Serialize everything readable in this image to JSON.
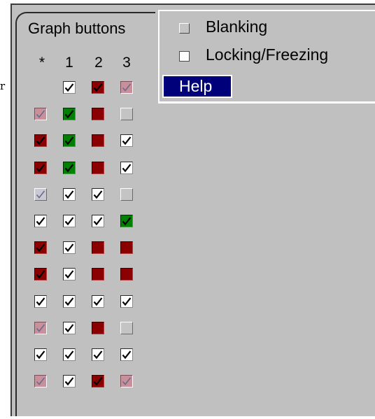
{
  "stray_text": "r",
  "graph_buttons": {
    "title": "Graph buttons",
    "column_headers": [
      "*",
      "1",
      "2",
      "3"
    ],
    "colors": {
      "white": "#ffffff",
      "red": "#8b0000",
      "green": "#008000",
      "pink": "#c8909a",
      "grey": "#c4c4c4",
      "light": "#c9c9d4"
    },
    "rows": [
      [
        null,
        {
          "state": "white",
          "checked": true
        },
        {
          "state": "red",
          "checked": true
        },
        {
          "state": "pink",
          "checked": true
        }
      ],
      [
        {
          "state": "pink",
          "checked": true
        },
        {
          "state": "green",
          "checked": true
        },
        {
          "state": "red",
          "checked": false
        },
        {
          "state": "grey",
          "checked": false
        }
      ],
      [
        {
          "state": "red",
          "checked": true
        },
        {
          "state": "green",
          "checked": true
        },
        {
          "state": "red",
          "checked": false
        },
        {
          "state": "white",
          "checked": true
        }
      ],
      [
        {
          "state": "red",
          "checked": true
        },
        {
          "state": "green",
          "checked": true
        },
        {
          "state": "red",
          "checked": false
        },
        {
          "state": "white",
          "checked": true
        }
      ],
      [
        {
          "state": "light",
          "checked": true
        },
        {
          "state": "white",
          "checked": true
        },
        {
          "state": "white",
          "checked": true
        },
        {
          "state": "grey",
          "checked": false
        }
      ],
      [
        {
          "state": "white",
          "checked": true
        },
        {
          "state": "white",
          "checked": true
        },
        {
          "state": "white",
          "checked": true
        },
        {
          "state": "green",
          "checked": true
        }
      ],
      [
        {
          "state": "red",
          "checked": true
        },
        {
          "state": "white",
          "checked": true
        },
        {
          "state": "red",
          "checked": false
        },
        {
          "state": "red",
          "checked": false
        }
      ],
      [
        {
          "state": "red",
          "checked": true
        },
        {
          "state": "white",
          "checked": true
        },
        {
          "state": "red",
          "checked": false
        },
        {
          "state": "red",
          "checked": false
        }
      ],
      [
        {
          "state": "white",
          "checked": true
        },
        {
          "state": "white",
          "checked": true
        },
        {
          "state": "white",
          "checked": true
        },
        {
          "state": "white",
          "checked": true
        }
      ],
      [
        {
          "state": "pink",
          "checked": true
        },
        {
          "state": "white",
          "checked": true
        },
        {
          "state": "red",
          "checked": false
        },
        {
          "state": "grey",
          "checked": false
        }
      ],
      [
        {
          "state": "white",
          "checked": true
        },
        {
          "state": "white",
          "checked": true
        },
        {
          "state": "white",
          "checked": true
        },
        {
          "state": "white",
          "checked": true
        }
      ],
      [
        {
          "state": "pink",
          "checked": true
        },
        {
          "state": "white",
          "checked": true
        },
        {
          "state": "red",
          "checked": true
        },
        {
          "state": "pink",
          "checked": true
        }
      ]
    ]
  },
  "popup_menu": {
    "blanking_label": "Blanking",
    "locking_label": "Locking/Freezing",
    "help_label": "Help"
  }
}
